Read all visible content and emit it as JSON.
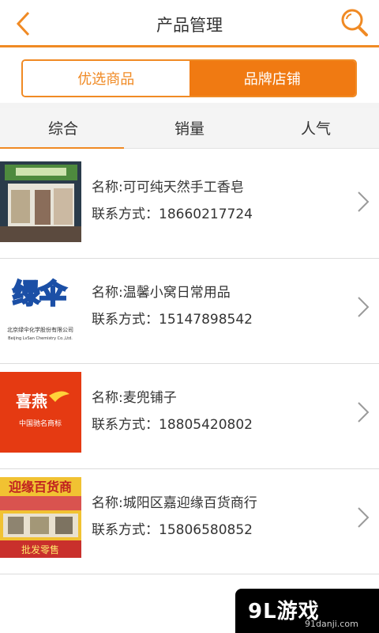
{
  "header": {
    "title": "产品管理",
    "back_icon": "chevron-left-icon",
    "search_icon": "search-icon",
    "accent_color": "#f08a24"
  },
  "segment": {
    "left_label": "优选商品",
    "right_label": "品牌店铺",
    "selected": "品牌店铺"
  },
  "sort_tabs": [
    {
      "label": "综合",
      "active": true
    },
    {
      "label": "销量",
      "active": false
    },
    {
      "label": "人气",
      "active": false
    }
  ],
  "stores": [
    {
      "name": "名称:可可纯天然手工香皂",
      "contact": "联系方式：18660217724"
    },
    {
      "name": "名称:温馨小窝日常用品",
      "contact": "联系方式：15147898542",
      "logo_text": "绿伞",
      "logo_caption": "北京绿伞化学股份有限公司",
      "logo_caption2": "Beijing LvSan Chemistry Co.,Ltd."
    },
    {
      "name": "名称:麦兜铺子",
      "contact": "联系方式：18805420802",
      "logo_text": "喜燕",
      "logo_caption": "中国驰名商标"
    },
    {
      "name": "名称:城阳区嘉迎缘百货商行",
      "contact": "联系方式：15806580852",
      "logo_text": "迎缘百货商",
      "logo_caption": "批发零售"
    }
  ],
  "watermark": {
    "logo": "9L游戏",
    "url": "91danji.com"
  }
}
